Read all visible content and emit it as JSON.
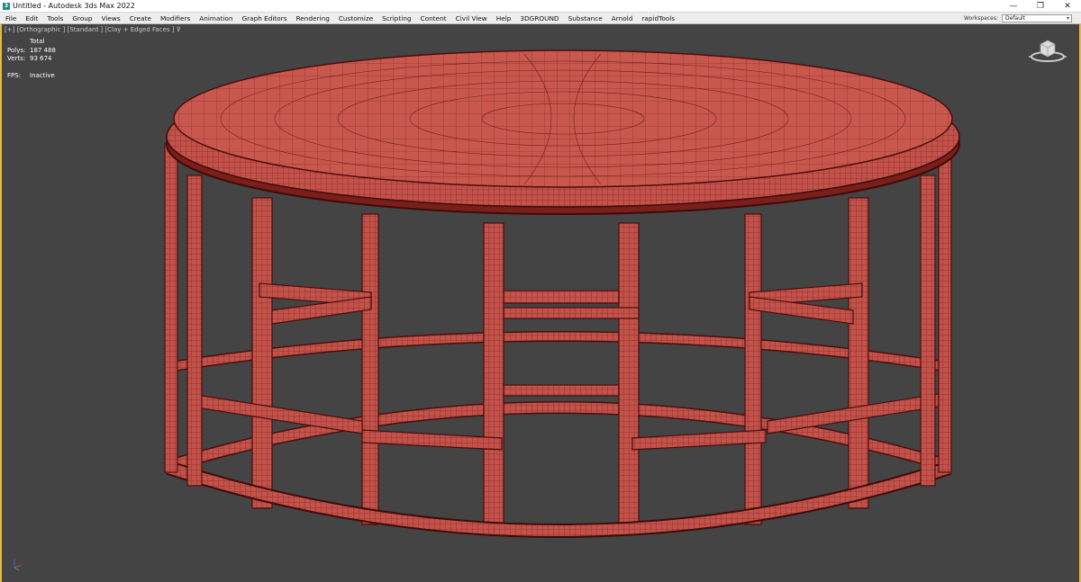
{
  "window": {
    "title": "Untitled - Autodesk 3ds Max 2022",
    "app_icon_glyph": "3",
    "controls": {
      "minimize": "—",
      "restore": "❐",
      "close": "✕"
    }
  },
  "menu": {
    "items": [
      "File",
      "Edit",
      "Tools",
      "Group",
      "Views",
      "Create",
      "Modifiers",
      "Animation",
      "Graph Editors",
      "Rendering",
      "Customize",
      "Scripting",
      "Content",
      "Civil View",
      "Help",
      "3DGROUND",
      "Substance",
      "Arnold",
      "rapidTools"
    ],
    "workspaces_label": "Workspaces:",
    "workspace_value": "Default"
  },
  "viewport": {
    "labels": [
      "[+]",
      "[Orthographic ]",
      "[Standard ]",
      "[Clay + Edged Faces ]"
    ],
    "filter_icon": "filter-icon",
    "stats": {
      "header": "Total",
      "polys_label": "Polys:",
      "polys_value": "187 488",
      "verts_label": "Verts:",
      "verts_value": "93 674",
      "fps_label": "FPS:",
      "fps_value": "Inactive"
    },
    "viewcube_icon": "viewcube-icon",
    "axis_icon": "axis-tripod-icon"
  },
  "colors": {
    "viewport_bg": "#444444",
    "active_border": "#e8b93b",
    "clay": "#c2524a",
    "wire": "#5a1010"
  }
}
